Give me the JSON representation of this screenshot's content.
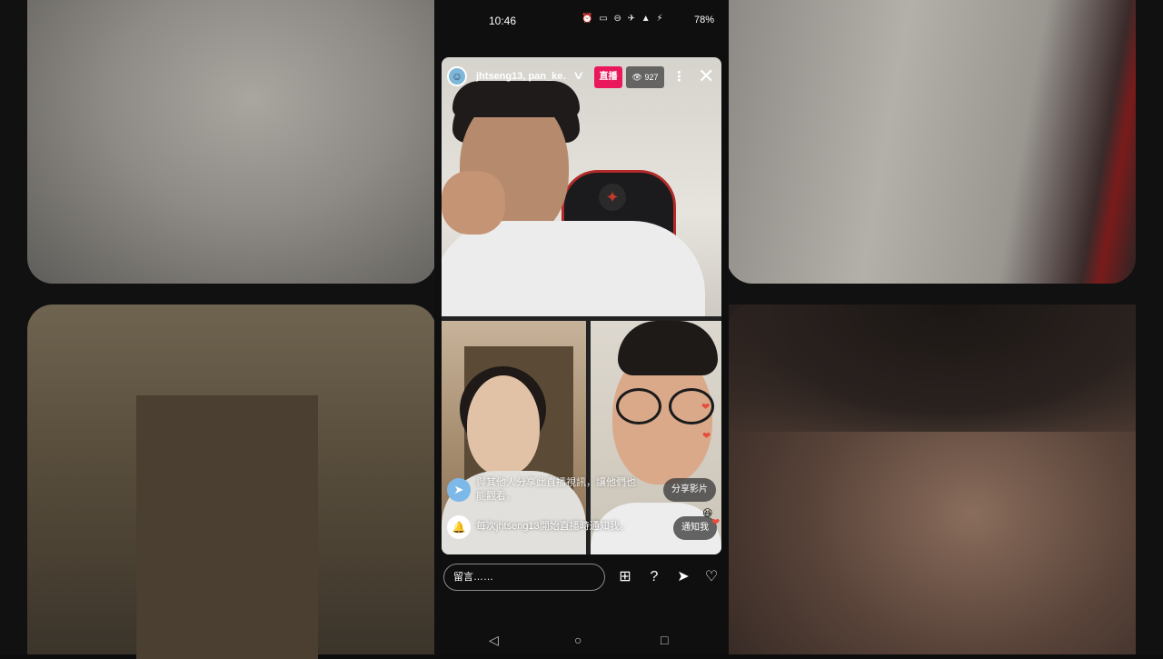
{
  "status_bar": {
    "time": "10:46",
    "icons": "⏰ ▭ ⊖ ✈ ▲ ⚡",
    "battery": "78%"
  },
  "live": {
    "host_names": "jhtseng13, pan_ke…",
    "live_label": "直播",
    "viewer_count": "927",
    "more_glyph": "⋮",
    "close_glyph": "✕",
    "chevron_glyph": "∨",
    "avatar_glyph": "☺"
  },
  "messages": {
    "share_prompt": "與其他人分享此直播視訊，讓他們也能觀看。",
    "share_button": "分享影片",
    "notify_prompt": "每次jhtseng13開始直播時通知我。",
    "notify_button": "通知我"
  },
  "reactions": [
    "❤",
    "❤",
    "😆",
    "❤"
  ],
  "comment_bar": {
    "placeholder": "留言……"
  },
  "actions": [
    {
      "name": "video-request-icon",
      "glyph": "⊞"
    },
    {
      "name": "question-icon",
      "glyph": "?"
    },
    {
      "name": "send-icon",
      "glyph": "➤"
    },
    {
      "name": "heart-icon",
      "glyph": "♡"
    }
  ],
  "navbar": {
    "back": "◁",
    "home": "○",
    "recents": "□"
  },
  "colors": {
    "live_badge": "#e9185c",
    "send_icon_bg": "#7db9e8"
  }
}
